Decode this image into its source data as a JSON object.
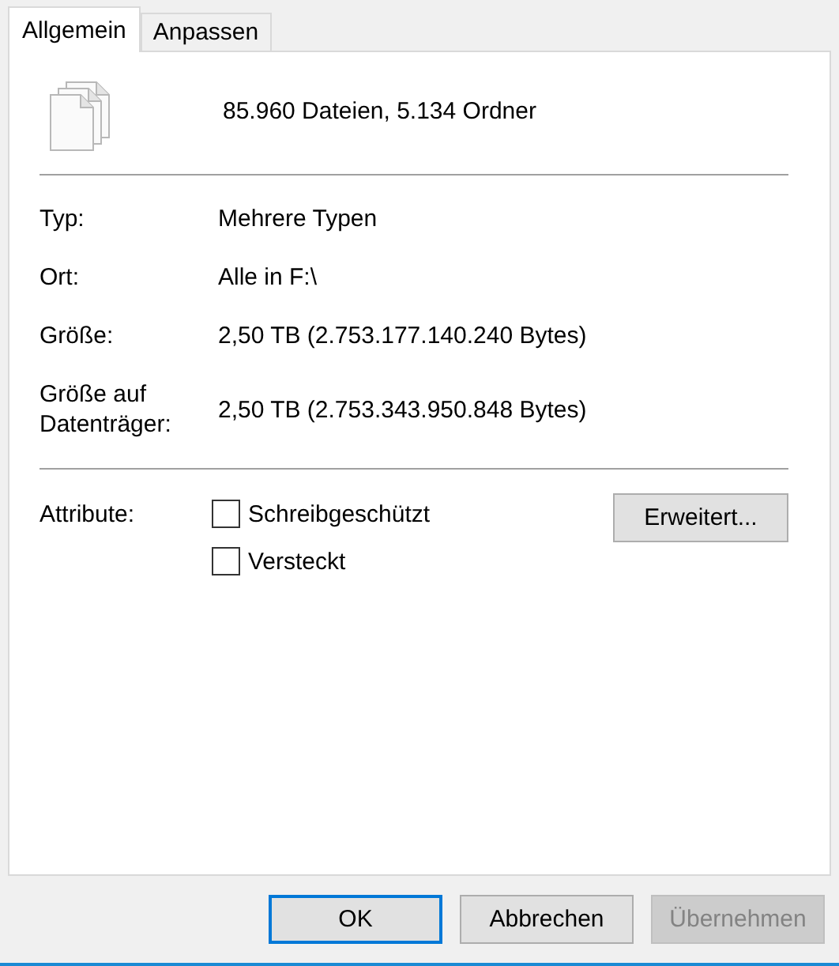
{
  "tabs": [
    {
      "label": "Allgemein",
      "selected": true
    },
    {
      "label": "Anpassen",
      "selected": false
    }
  ],
  "summary": "85.960 Dateien, 5.134 Ordner",
  "properties": [
    {
      "label": "Typ:",
      "value": "Mehrere Typen"
    },
    {
      "label": "Ort:",
      "value": "Alle in F:\\"
    },
    {
      "label": "Größe:",
      "value": "2,50 TB (2.753.177.140.240 Bytes)"
    },
    {
      "label": "Größe auf Datenträger:",
      "value": "2,50 TB (2.753.343.950.848 Bytes)"
    }
  ],
  "attributes": {
    "label": "Attribute:",
    "checkboxes": [
      {
        "label": "Schreibgeschützt",
        "checked": false
      },
      {
        "label": "Versteckt",
        "checked": false
      }
    ],
    "advanced_button": "Erweitert..."
  },
  "buttons": [
    {
      "label": "OK",
      "default": true,
      "disabled": false
    },
    {
      "label": "Abbrechen",
      "default": false,
      "disabled": false
    },
    {
      "label": "Übernehmen",
      "default": false,
      "disabled": true
    }
  ]
}
